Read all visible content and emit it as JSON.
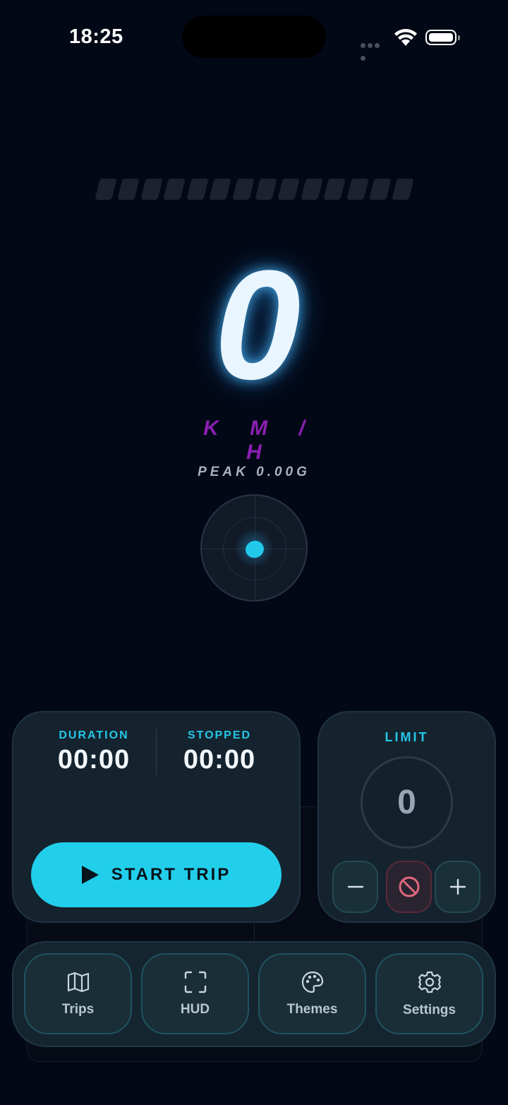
{
  "status_bar": {
    "time": "18:25"
  },
  "speed": {
    "value": "0",
    "unit": "K M / H",
    "peak": "PEAK 0.00G",
    "segments_total": 14,
    "segments_active": 0
  },
  "trip": {
    "duration_label": "DURATION",
    "duration_value": "00:00",
    "stopped_label": "STOPPED",
    "stopped_value": "00:00",
    "start_label": "START TRIP"
  },
  "limit": {
    "label": "LIMIT",
    "value": "0"
  },
  "tabs": [
    {
      "label": "Trips",
      "icon": "map-icon"
    },
    {
      "label": "HUD",
      "icon": "scan-frame-icon"
    },
    {
      "label": "Themes",
      "icon": "palette-icon"
    },
    {
      "label": "Settings",
      "icon": "gear-icon"
    }
  ],
  "colors": {
    "accent": "#22cfeb",
    "unit": "#8a1fb0",
    "background": "#030816"
  }
}
